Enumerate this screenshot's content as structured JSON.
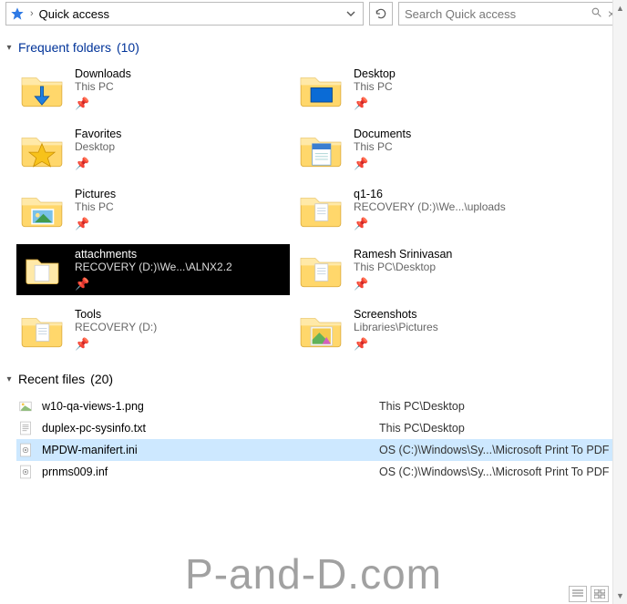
{
  "address": {
    "crumb": "Quick access",
    "separator": "›"
  },
  "search": {
    "placeholder": "Search Quick access"
  },
  "sections": {
    "folders": {
      "label": "Frequent folders",
      "count": "(10)"
    },
    "files": {
      "label": "Recent files",
      "count": "(20)"
    }
  },
  "folders": [
    {
      "name": "Downloads",
      "path": "This PC",
      "icon": "downloads"
    },
    {
      "name": "Desktop",
      "path": "This PC",
      "icon": "desktop"
    },
    {
      "name": "Favorites",
      "path": "Desktop",
      "icon": "favorites"
    },
    {
      "name": "Documents",
      "path": "This PC",
      "icon": "documents"
    },
    {
      "name": "Pictures",
      "path": "This PC",
      "icon": "pictures"
    },
    {
      "name": "q1-16",
      "path": "RECOVERY (D:)\\We...\\uploads",
      "icon": "folder"
    },
    {
      "name": "attachments",
      "path": "RECOVERY (D:)\\We...\\ALNX2.2",
      "icon": "folder",
      "selected": true
    },
    {
      "name": "Ramesh Srinivasan",
      "path": "This PC\\Desktop",
      "icon": "folder"
    },
    {
      "name": "Tools",
      "path": "RECOVERY (D:)",
      "icon": "folder"
    },
    {
      "name": "Screenshots",
      "path": "Libraries\\Pictures",
      "icon": "screenshots"
    }
  ],
  "recent": [
    {
      "name": "w10-qa-views-1.png",
      "path": "This PC\\Desktop",
      "icon": "image"
    },
    {
      "name": "duplex-pc-sysinfo.txt",
      "path": "This PC\\Desktop",
      "icon": "text"
    },
    {
      "name": "MPDW-manifert.ini",
      "path": "OS (C:)\\Windows\\Sy...\\Microsoft Print To PDF",
      "icon": "ini",
      "selected": true
    },
    {
      "name": "prnms009.inf",
      "path": "OS (C:)\\Windows\\Sy...\\Microsoft Print To PDF",
      "icon": "inf"
    }
  ],
  "watermark": "P-and-D.com"
}
